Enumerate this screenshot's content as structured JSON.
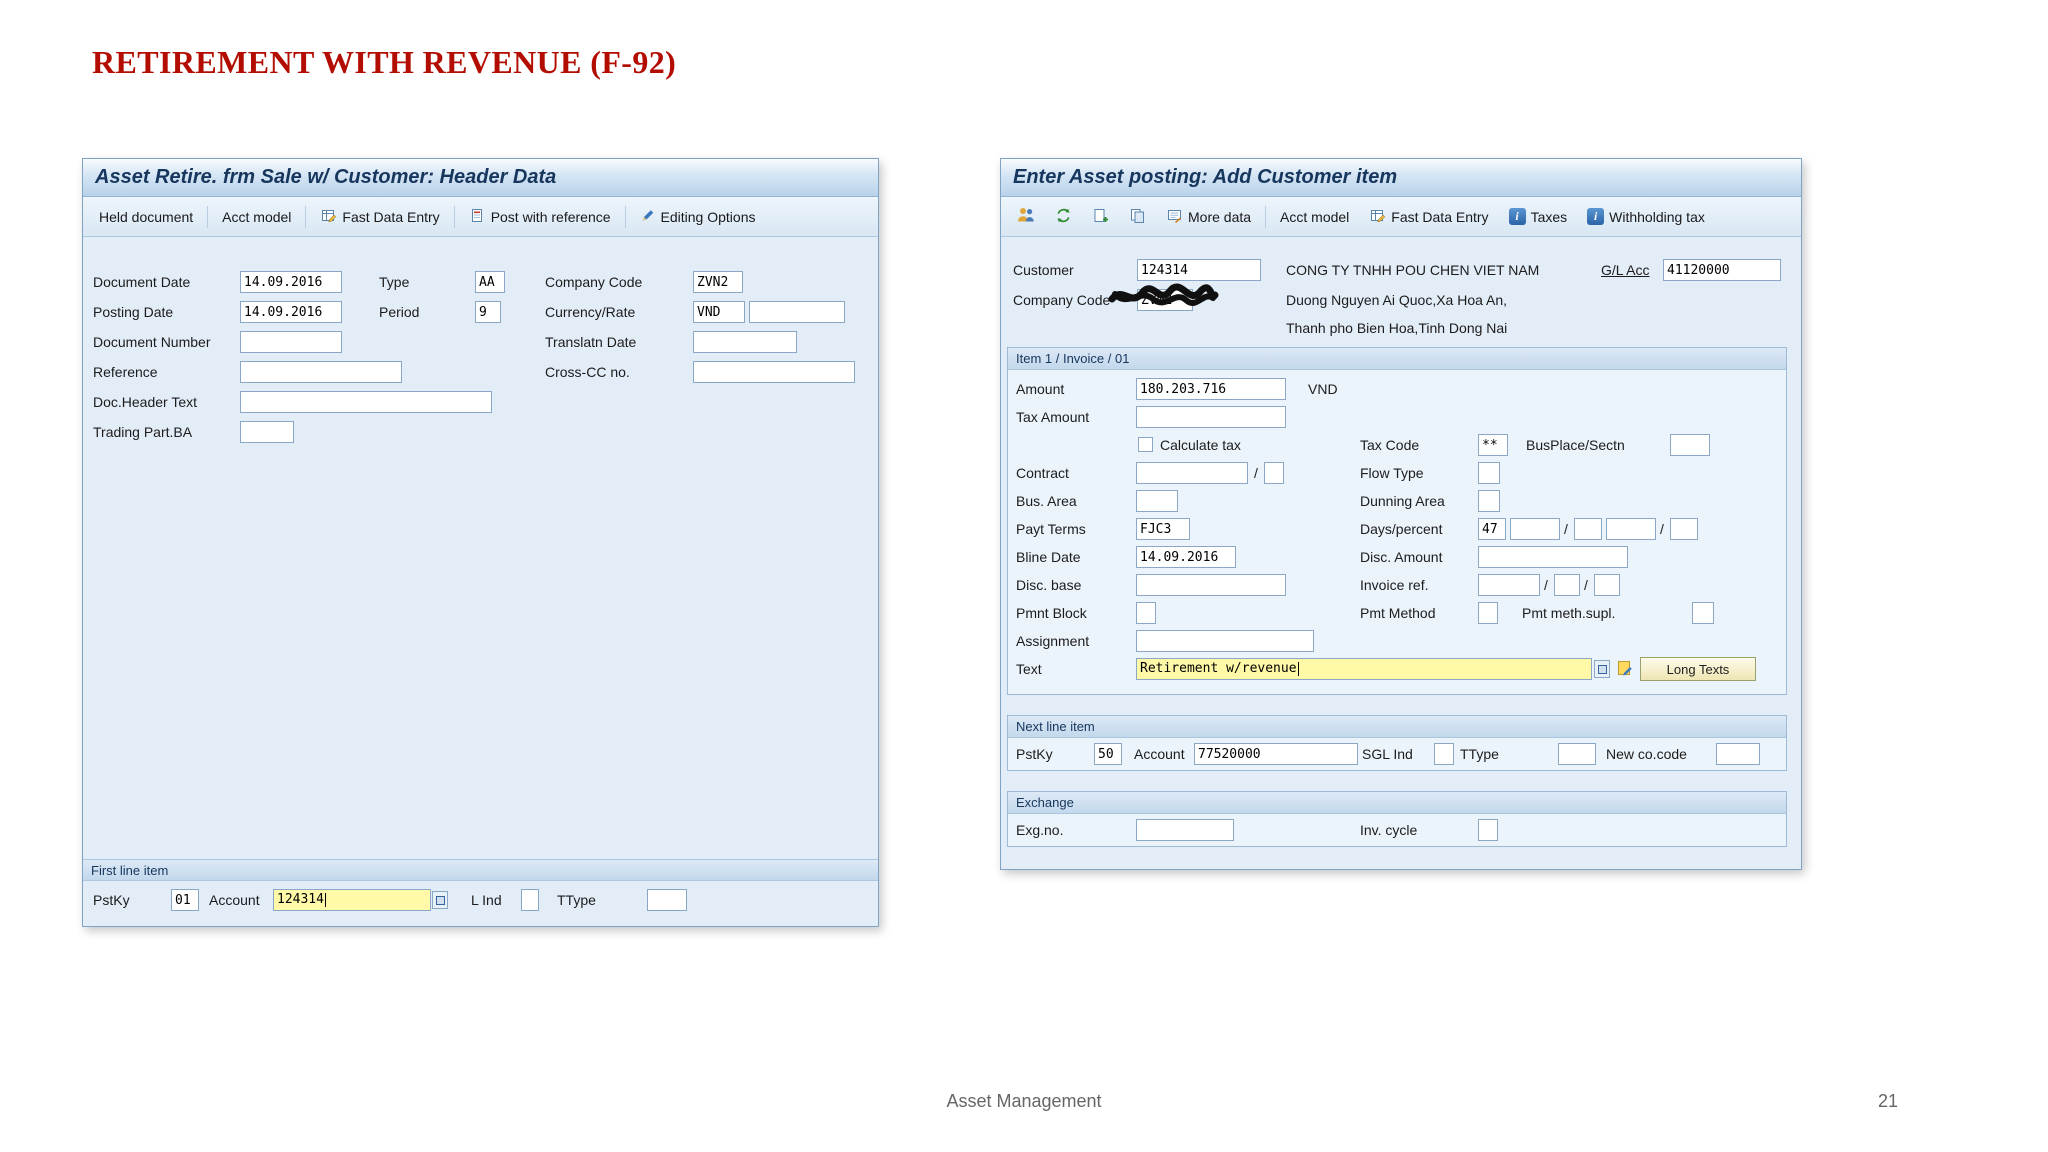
{
  "page": {
    "title": "RETIREMENT WITH REVENUE (F-92)",
    "footer_text": "Asset Management",
    "page_number": "21",
    "glyphs": {
      "slash": "/"
    },
    "colors": {
      "title_red": "#b30d02",
      "highlight_yellow": "#fff9a8",
      "sap_header_blue": "#17365d"
    }
  },
  "left_window": {
    "title": "Asset Retire. frm Sale w/ Customer: Header Data",
    "toolbar": {
      "held_document": "Held document",
      "acct_model": "Acct model",
      "fast_data_entry": "Fast Data Entry",
      "post_with_reference": "Post with reference",
      "editing_options": "Editing Options"
    },
    "fields": {
      "document_date": {
        "label": "Document Date",
        "value": "14.09.2016"
      },
      "type": {
        "label": "Type",
        "value": "AA"
      },
      "company_code": {
        "label": "Company Code",
        "value": "ZVN2"
      },
      "posting_date": {
        "label": "Posting Date",
        "value": "14.09.2016"
      },
      "period": {
        "label": "Period",
        "value": "9"
      },
      "currency_rate": {
        "label": "Currency/Rate",
        "value": "VND",
        "value2": ""
      },
      "document_number": {
        "label": "Document Number",
        "value": ""
      },
      "translatn_date": {
        "label": "Translatn Date",
        "value": ""
      },
      "reference": {
        "label": "Reference",
        "value": ""
      },
      "cross_cc_no": {
        "label": "Cross-CC no.",
        "value": ""
      },
      "doc_header_text": {
        "label": "Doc.Header Text",
        "value": ""
      },
      "trading_part_ba": {
        "label": "Trading Part.BA",
        "value": ""
      }
    },
    "first_line_item": {
      "section_title": "First line item",
      "pstky_label": "PstKy",
      "pstky_value": "01",
      "account_label": "Account",
      "account_value": "124314",
      "l_ind_label": "L Ind",
      "l_ind_value": "",
      "ttype_label": "TType",
      "ttype_value": ""
    }
  },
  "right_window": {
    "title": "Enter Asset posting: Add Customer item",
    "toolbar": {
      "more_data": "More data",
      "acct_model": "Acct model",
      "fast_data_entry": "Fast Data Entry",
      "taxes": "Taxes",
      "withholding_tax": "Withholding tax",
      "info_glyph": "i"
    },
    "header": {
      "customer_label": "Customer",
      "customer_value": "124314",
      "customer_name": "CONG TY TNHH POU CHEN VIET NAM",
      "gl_acc_label": "G/L Acc",
      "gl_acc_value": "41120000",
      "company_code_label": "Company Code",
      "company_code_value": "ZVN2",
      "address_line1": "Duong Nguyen Ai Quoc,Xa Hoa An,",
      "address_line2": "Thanh pho Bien Hoa,Tinh Dong Nai"
    },
    "item": {
      "section_title": "Item 1 / Invoice / 01",
      "amount_label": "Amount",
      "amount_value": "180.203.716",
      "currency": "VND",
      "tax_amount_label": "Tax Amount",
      "tax_amount_value": "",
      "calculate_tax_label": "Calculate tax",
      "calculate_tax_checked": false,
      "tax_code_label": "Tax Code",
      "tax_code_value": "**",
      "busplace_label": "BusPlace/Sectn",
      "busplace_value": "",
      "contract_label": "Contract",
      "contract_value": "",
      "contract_type": "",
      "flow_type_label": "Flow Type",
      "flow_type_value": "",
      "bus_area_label": "Bus. Area",
      "bus_area_value": "",
      "dunning_area_label": "Dunning Area",
      "dunning_area_value": "",
      "payt_terms_label": "Payt Terms",
      "payt_terms_value": "FJC3",
      "days_percent_label": "Days/percent",
      "days1": "47",
      "percent1": "",
      "days2": "",
      "percent2": "",
      "days3": "",
      "bline_date_label": "Bline Date",
      "bline_date_value": "14.09.2016",
      "disc_amount_label": "Disc. Amount",
      "disc_amount_value": "",
      "disc_base_label": "Disc. base",
      "disc_base_value": "",
      "invoice_ref_label": "Invoice ref.",
      "invoice_ref_value": "",
      "invoice_ref_year": "",
      "invoice_ref_item": "",
      "pmnt_block_label": "Pmnt Block",
      "pmnt_block_value": "",
      "pmt_method_label": "Pmt Method",
      "pmt_method_value": "",
      "pmt_meth_supl_label": "Pmt meth.supl.",
      "pmt_meth_supl_value": "",
      "assignment_label": "Assignment",
      "assignment_value": "",
      "text_label": "Text",
      "text_value": "Retirement w/revenue",
      "long_texts_label": "Long Texts"
    },
    "next_line": {
      "section_title": "Next line item",
      "pstky_label": "PstKy",
      "pstky_value": "50",
      "account_label": "Account",
      "account_value": "77520000",
      "sgl_ind_label": "SGL Ind",
      "sgl_ind_value": "",
      "ttype_label": "TType",
      "ttype_value": "",
      "new_co_code_label": "New co.code",
      "new_co_code_value": ""
    },
    "exchange": {
      "section_title": "Exchange",
      "exg_no_label": "Exg.no.",
      "exg_no_value": "",
      "inv_cycle_label": "Inv. cycle",
      "inv_cycle_value": ""
    }
  }
}
